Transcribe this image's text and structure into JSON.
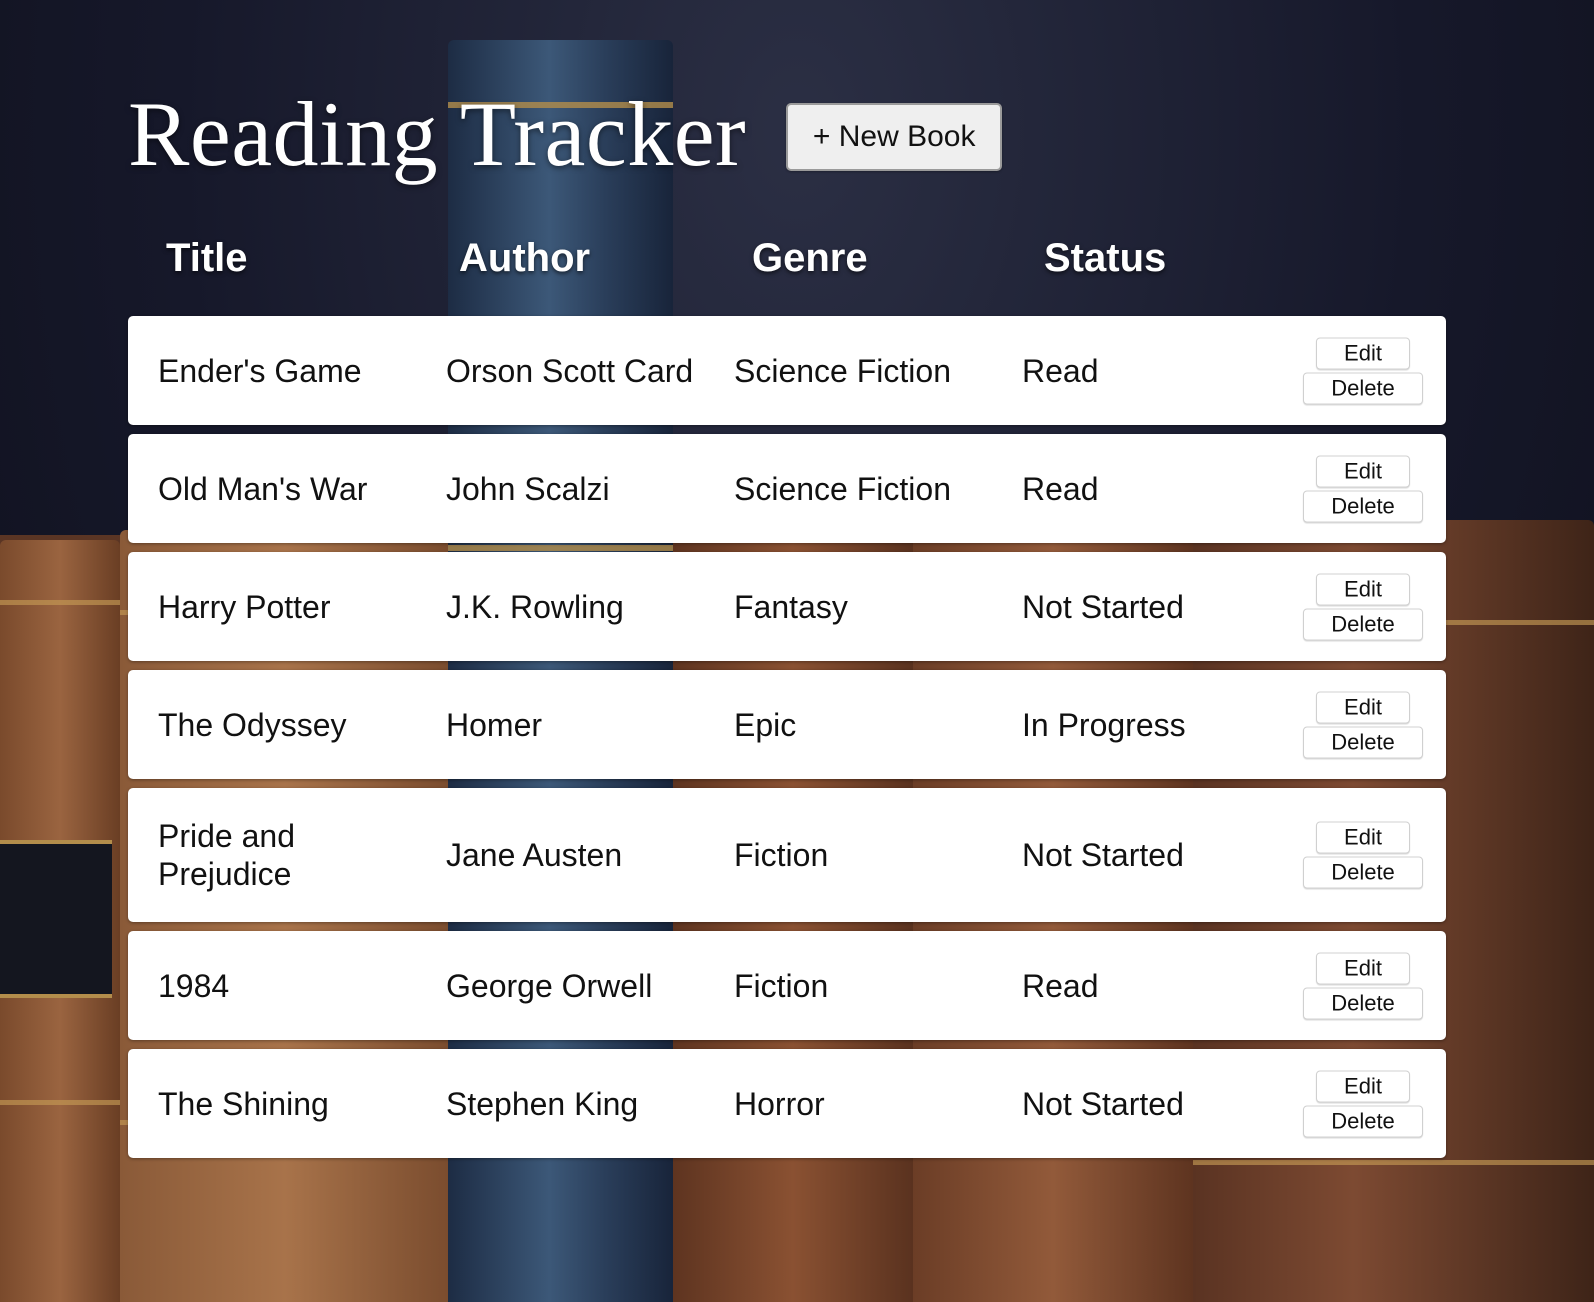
{
  "header": {
    "title": "Reading Tracker",
    "new_book_label": "+ New Book"
  },
  "columns": {
    "title": "Title",
    "author": "Author",
    "genre": "Genre",
    "status": "Status"
  },
  "actions": {
    "edit_label": "Edit",
    "delete_label": "Delete"
  },
  "books": [
    {
      "title": "Ender's Game",
      "author": "Orson Scott Card",
      "genre": "Science Fiction",
      "status": "Read"
    },
    {
      "title": "Old Man's War",
      "author": "John Scalzi",
      "genre": "Science Fiction",
      "status": "Read"
    },
    {
      "title": "Harry Potter",
      "author": "J.K. Rowling",
      "genre": "Fantasy",
      "status": "Not Started"
    },
    {
      "title": "The Odyssey",
      "author": "Homer",
      "genre": "Epic",
      "status": "In Progress"
    },
    {
      "title": "Pride and Prejudice",
      "author": "Jane Austen",
      "genre": "Fiction",
      "status": "Not Started"
    },
    {
      "title": "1984",
      "author": "George Orwell",
      "genre": "Fiction",
      "status": "Read"
    },
    {
      "title": "The Shining",
      "author": "Stephen King",
      "genre": "Horror",
      "status": "Not Started"
    }
  ]
}
